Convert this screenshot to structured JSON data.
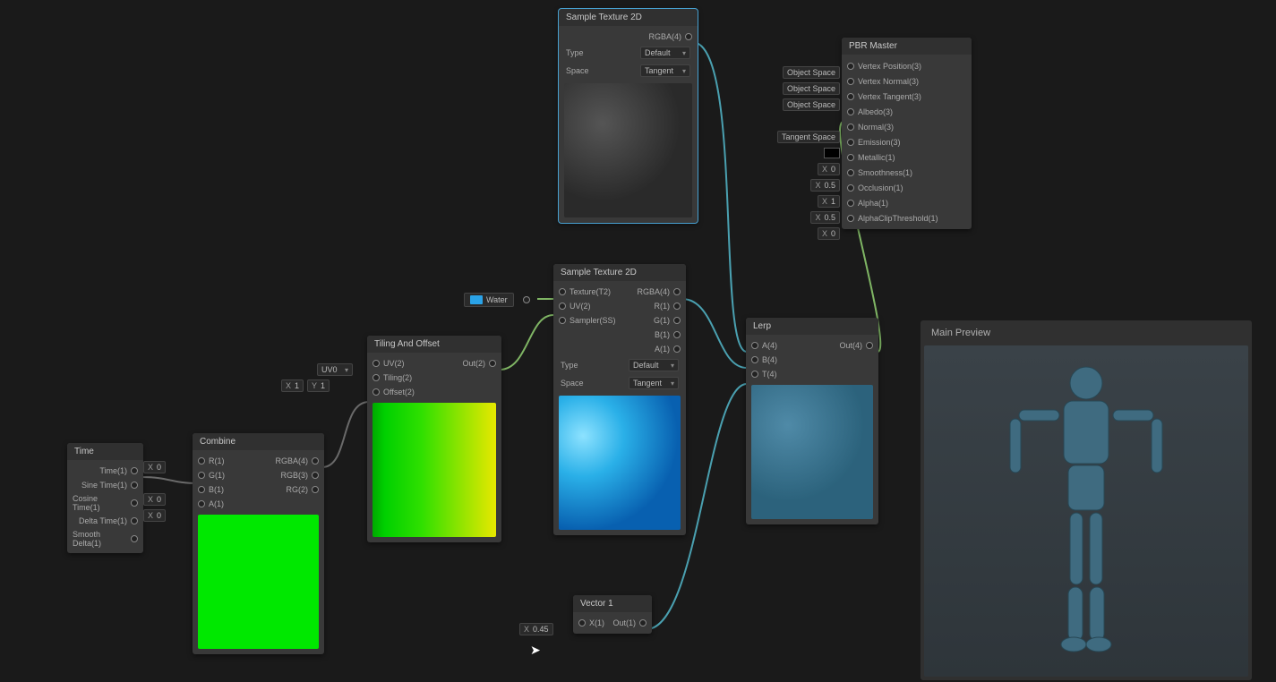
{
  "nodes": {
    "time": {
      "title": "Time",
      "outputs": [
        "Time(1)",
        "Sine Time(1)",
        "Cosine Time(1)",
        "Delta Time(1)",
        "Smooth Delta(1)"
      ]
    },
    "combine": {
      "title": "Combine",
      "inputs": [
        "R(1)",
        "G(1)",
        "B(1)",
        "A(1)"
      ],
      "outputs": [
        "RGBA(4)",
        "RGB(3)",
        "RG(2)"
      ],
      "ext_r": "0",
      "ext_b": "0",
      "ext_a": "0"
    },
    "tilingOffset": {
      "title": "Tiling And Offset",
      "inputs": [
        "UV(2)",
        "Tiling(2)",
        "Offset(2)"
      ],
      "output": "Out(2)",
      "uvDropdown": "UV0",
      "tilingX": "1",
      "tilingY": "1"
    },
    "waterProp": {
      "label": "Water"
    },
    "sampleTex1": {
      "title": "Sample Texture 2D",
      "rgbaLabel": "RGBA(4)",
      "typeLabel": "Type",
      "typeValue": "Default",
      "spaceLabel": "Space",
      "spaceValue": "Tangent"
    },
    "sampleTex2": {
      "title": "Sample Texture 2D",
      "inputs": [
        "Texture(T2)",
        "UV(2)",
        "Sampler(SS)"
      ],
      "outputs": [
        "RGBA(4)",
        "R(1)",
        "G(1)",
        "B(1)",
        "A(1)"
      ],
      "typeLabel": "Type",
      "typeValue": "Default",
      "spaceLabel": "Space",
      "spaceValue": "Tangent"
    },
    "vector1": {
      "title": "Vector 1",
      "input": "X(1)",
      "output": "Out(1)",
      "value": "0.45"
    },
    "lerp": {
      "title": "Lerp",
      "inputs": [
        "A(4)",
        "B(4)",
        "T(4)"
      ],
      "output": "Out(4)"
    },
    "pbr": {
      "title": "PBR Master",
      "rows": [
        {
          "pill": "Object Space",
          "label": "Vertex Position(3)"
        },
        {
          "pill": "Object Space",
          "label": "Vertex Normal(3)"
        },
        {
          "pill": "Object Space",
          "label": "Vertex Tangent(3)"
        },
        {
          "label": "Albedo(3)"
        },
        {
          "pill": "Tangent Space",
          "label": "Normal(3)"
        },
        {
          "swatch": true,
          "label": "Emission(3)"
        },
        {
          "pillX": "0",
          "label": "Metallic(1)"
        },
        {
          "pillX": "0.5",
          "label": "Smoothness(1)"
        },
        {
          "pillX": "1",
          "label": "Occlusion(1)"
        },
        {
          "pillX": "0.5",
          "label": "Alpha(1)"
        },
        {
          "pillX": "0",
          "label": "AlphaClipThreshold(1)"
        }
      ]
    }
  },
  "preview": {
    "title": "Main Preview"
  }
}
